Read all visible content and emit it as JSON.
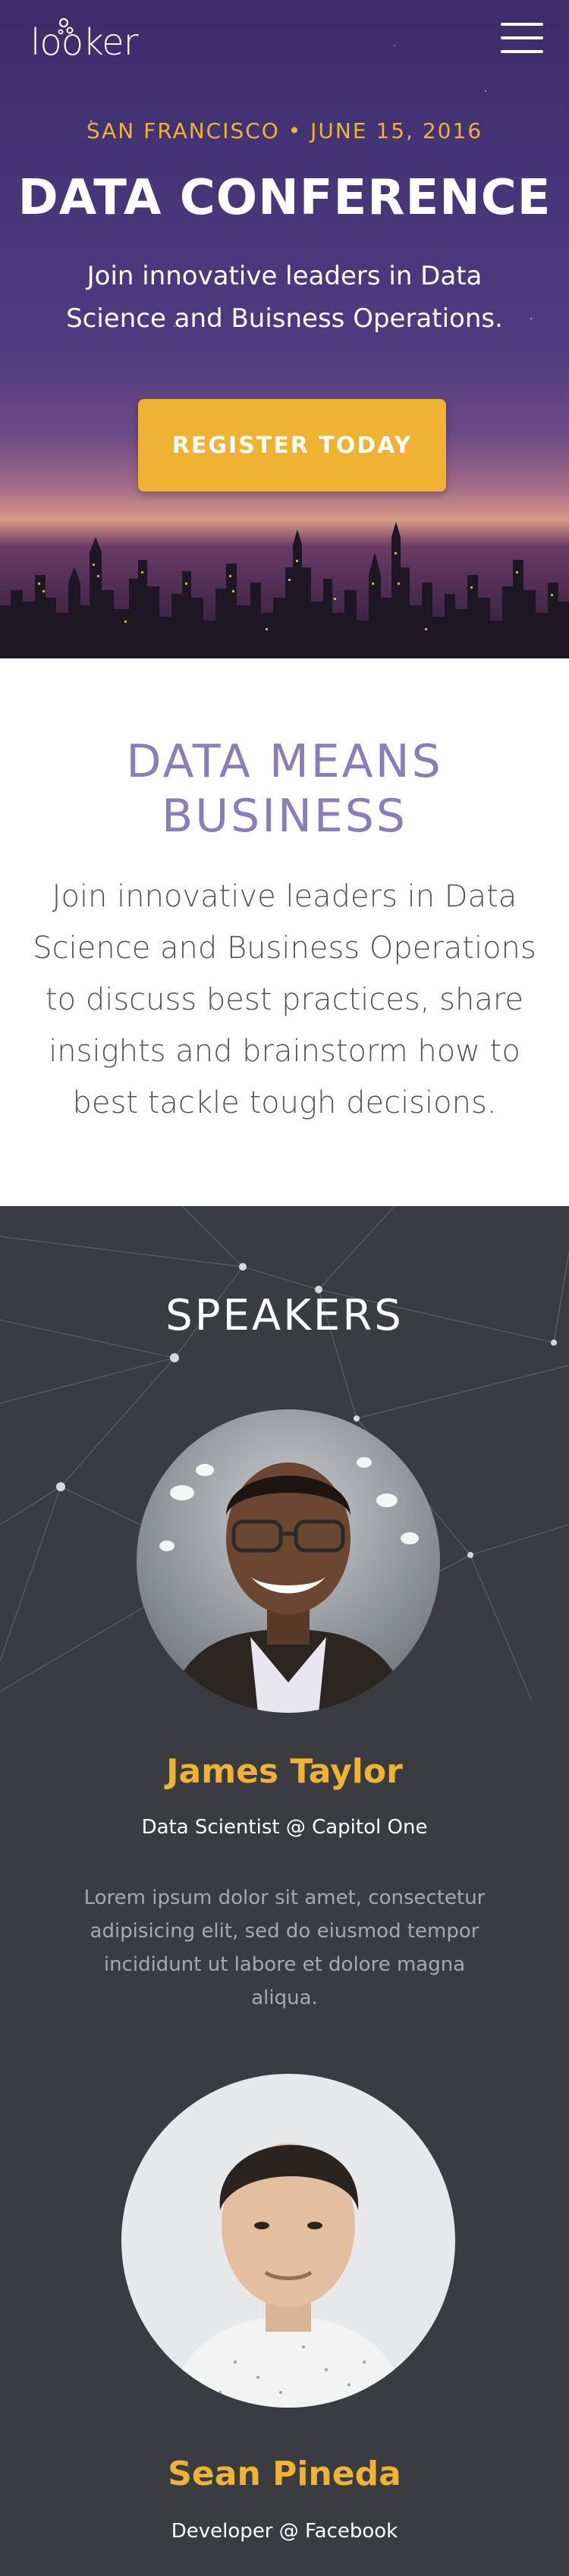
{
  "header": {
    "logo_text": "looker",
    "menu_icon": "hamburger-menu-icon"
  },
  "hero": {
    "meta": "SAN FRANCISCO • JUNE 15, 2016",
    "title": "DATA CONFERENCE",
    "subtitle": "Join innovative leaders in Data Science and Buisness Operations.",
    "register_label": "REGISTER TODAY"
  },
  "about": {
    "title": "DATA MEANS BUSINESS",
    "body": "Join innovative leaders in Data Science and Business Operations to discuss best practices, share insights and brainstorm how to best tackle tough decisions."
  },
  "speakers": {
    "title": "SPEAKERS",
    "items": [
      {
        "name": "James Taylor",
        "role": "Data Scientist @ Capitol One",
        "bio": "Lorem ipsum dolor sit amet, consectetur adipisicing elit, sed do eiusmod tempor incididunt ut labore et dolore magna aliqua."
      },
      {
        "name": "Sean Pineda",
        "role": "Developer @ Facebook"
      }
    ]
  },
  "colors": {
    "accent": "#f0b232",
    "lavender": "#8a7db9",
    "dark_bg": "#3b3c41"
  }
}
